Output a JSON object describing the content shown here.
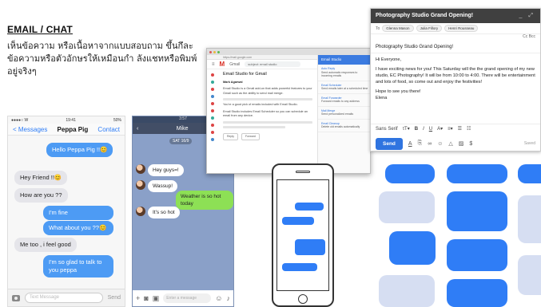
{
  "header": {
    "title": "EMAIL / CHAT",
    "description": "เห็นข้อความ หรือเนื้อหาจากแบบสอบถาม ขึ้นกึละข้อความหรือตัวอักษรให้เหมือนกำ ลังแชทหรือพิมพ์อยู่จริงๆ"
  },
  "imessage": {
    "status_left": "●●●●○ W",
    "status_time": "19:41",
    "status_right": "50%",
    "back_label": "< Messages",
    "contact_name": "Peppa Pig",
    "contact_label": "Contact",
    "messages": [
      {
        "side": "right",
        "text": "Hello Peppa Pig !!😊"
      },
      {
        "side": "left",
        "text": "Hey Friend !!😊"
      },
      {
        "side": "left",
        "text": "How are you ??"
      },
      {
        "side": "right",
        "text": "I'm fine"
      },
      {
        "side": "right",
        "text": "What about you ??😊"
      },
      {
        "side": "left",
        "text": "Me too , i feel good"
      },
      {
        "side": "right",
        "text": "I'm so glad to talk to you peppa"
      }
    ],
    "input_placeholder": "Text Message",
    "send_label": "Send"
  },
  "line_chat": {
    "status_time": "3:57",
    "contact_name": "Mike",
    "date_label": "SAT 16/9",
    "messages": [
      {
        "side": "left",
        "text": "Hey guys=!"
      },
      {
        "side": "left",
        "text": "Wassup!"
      },
      {
        "side": "right",
        "text": "Weather is so hot today"
      },
      {
        "side": "left",
        "text": "It's so hot"
      }
    ],
    "input_placeholder": "Enter a message"
  },
  "gmail": {
    "logo_label": "M",
    "app_name": "Gmail",
    "search_text": "subject: email studio",
    "url_text": "https://mail.google.com",
    "subject": "Email Studio for Gmail",
    "sender": "Mark Agarwal",
    "body": [
      "Email Studio is a Gmail add-on that adds powerful features to your Gmail such as the ability to send mail merge.",
      "You're a good pick of emails included with Email Studio.",
      "Email Studio includes Email Scheduler so you can schedule an email from any device."
    ],
    "reply_label": "Reply",
    "forward_label": "Forward",
    "panel_title": "Email Studio",
    "panel_items": [
      {
        "name": "Auto Reply",
        "text": "Send automatic responses to incoming emails"
      },
      {
        "name": "Email Scheduler",
        "text": "Send emails later at a scheduled time"
      },
      {
        "name": "Email Forwarder",
        "text": "Forward emails to any address"
      },
      {
        "name": "Mail Merge",
        "text": "Send personalized emails"
      },
      {
        "name": "Email Cleanup",
        "text": "Delete old emails automatically"
      }
    ]
  },
  "compose": {
    "title": "Photography Studio Grand Opening!",
    "controls": "_ ⤢",
    "to_label": "To",
    "recipients": [
      "Glenna Mason",
      "Julia Fillory",
      "Henri Rousseau"
    ],
    "cc_label": "Cc Bcc",
    "subject": "Photography Studio Grand Opening!",
    "greeting": "Hi Everyone,",
    "body": "I have exciting news for you! This Saturday will the the grand opening of my new studio, EC Photography! It will be from 10:00 to 4:00. There will be entertainment and lots of food, so come out and enjoy the festivities!",
    "closing": "Hope to see you there!",
    "signature": "Elena",
    "font_label": "Sans Serif",
    "send_label": "Send",
    "saved_label": "Saved"
  },
  "colors": {
    "imessage_blue": "#4d9bf4",
    "bubble_blue": "#2f7df6",
    "line_bg": "#8aa0c8",
    "line_green": "#8de055",
    "gmail_red": "#d93025"
  }
}
